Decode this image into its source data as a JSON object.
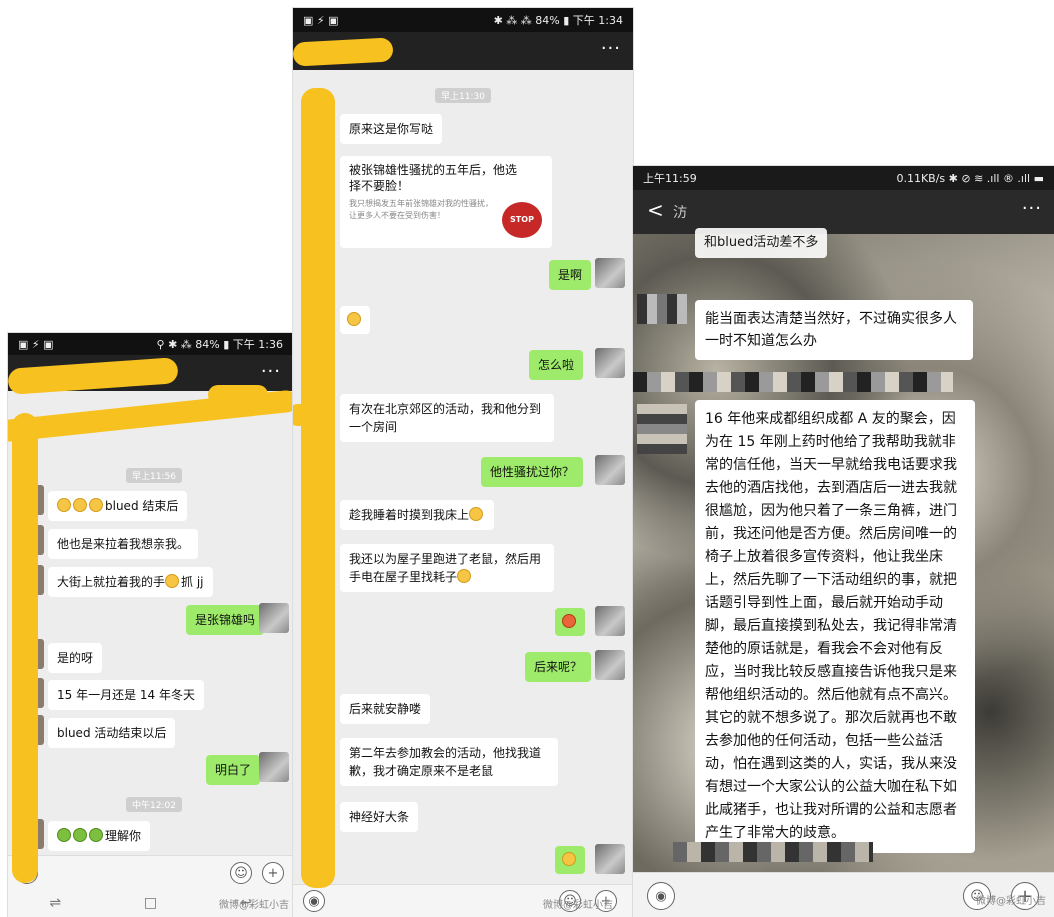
{
  "screen1": {
    "status_left": "▣ ⚡ ▣",
    "status_right": "⚲ ✱ ⁂ 84% ▮ 下午 1:36",
    "more": "···",
    "time_chip_1": "早上11:56",
    "time_chip_2": "中午12:02",
    "messages": [
      {
        "side": "left",
        "text": "blued 结束后",
        "emoji_prefix": 3
      },
      {
        "side": "left",
        "text": "他也是来拉着我想亲我。"
      },
      {
        "side": "left",
        "text": "大街上就拉着我的手",
        "suffix": "抓 jj"
      },
      {
        "side": "right",
        "text": "是张锦雄吗"
      },
      {
        "side": "left",
        "text": "是的呀"
      },
      {
        "side": "left",
        "text": "15 年一月还是 14 年冬天"
      },
      {
        "side": "left",
        "text": "blued 活动结束以后"
      },
      {
        "side": "right",
        "text": "明白了"
      },
      {
        "side": "left",
        "text": "理解你",
        "emoji_prefix": 3
      }
    ],
    "nav": [
      "⇌",
      "□",
      "↩"
    ],
    "watermark": "微博@彩虹小吉"
  },
  "screen2": {
    "status_left": "▣ ⚡ ▣",
    "status_right": "✱ ⁂ ⁂ 84% ▮ 下午 1:34",
    "more": "···",
    "time_chip": "早上11:30",
    "msg1": "原来这是你写哒",
    "card_title": "被张锦雄性骚扰的五年后，他选择不要脸！",
    "card_desc": "我只想揭发五年前张锦雄对我的性骚扰，让更多人不要在受到伤害！",
    "card_badge": "STOP",
    "msg_right_1": "是啊",
    "msg_right_2": "怎么啦",
    "msg_left_2": "有次在北京郊区的活动，我和他分到一个房间",
    "msg_right_3": "他性骚扰过你？",
    "msg_left_3": "趁我睡着时摸到我床上",
    "msg_left_4": "我还以为屋子里跑进了老鼠，然后用手电在屋子里找耗子",
    "msg_right_5": "后来呢？",
    "msg_left_5": "后来就安静喽",
    "msg_left_6": "第二年去参加教会的活动，他找我道歉，我才确定原来不是老鼠",
    "msg_left_7": "神经好大条",
    "watermark": "微博@彩虹小吉"
  },
  "screen3": {
    "status_time": "上午11:59",
    "status_right": "0.11KB/s ✱ ⊘ ≋ .ıll ® .ıll ▬",
    "back": "<",
    "title_partial": "汸",
    "more": "···",
    "msg_top_partial": "和blued活动差不多",
    "msg1": "能当面表达清楚当然好，不过确实很多人一时不知道怎么办",
    "msg2": "16 年他来成都组织成都 A 友的聚会，因为在 15 年刚上药时他给了我帮助我就非常的信任他，当天一早就给我电话要求我去他的酒店找他，去到酒店后一进去我就很尴尬，因为他只着了一条三角裤，进门前，我还问他是否方便。然后房间唯一的椅子上放着很多宣传资料，他让我坐床上，然后先聊了一下活动组织的事，就把话题引导到性上面，最后就开始动手动脚，最后直接摸到私处去，我记得非常清楚他的原话就是，看我会不会对他有反应，当时我比较反感直接告诉他我只是来帮他组织活动的。然后他就有点不高兴。其它的就不想多说了。那次后就再也不敢去参加他的任何活动，包括一些公益活动，怕在遇到这类的人，实话，我从来没有想过一个大家公认的公益大咖在私下如此咸猪手，也让我对所谓的公益和志愿者产生了非常大的歧意。",
    "watermark": "微博@彩虹小吉"
  },
  "colors": {
    "bubble_right": "#9eea6a",
    "bubble_left": "#ffffff",
    "redaction": "#f7c11f",
    "topbar": "#222222"
  }
}
